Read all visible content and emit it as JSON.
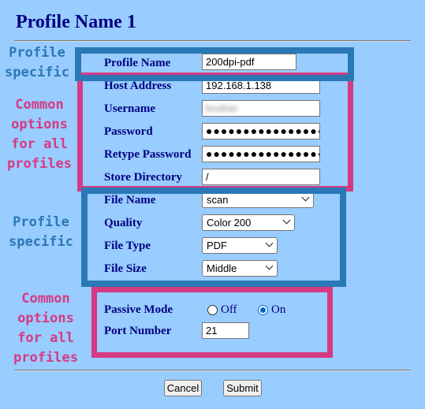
{
  "page": {
    "title": "Profile Name 1"
  },
  "annotations": {
    "profile_specific_1": [
      "Profile",
      "specific"
    ],
    "common_1": [
      "Common",
      "options",
      "for all",
      "profiles"
    ],
    "profile_specific_2": [
      "Profile",
      "specific"
    ],
    "common_2": [
      "Common",
      "options",
      "for all",
      "profiles"
    ]
  },
  "fields": {
    "profile_name": {
      "label": "Profile Name",
      "value": "200dpi-pdf"
    },
    "host_address": {
      "label": "Host Address",
      "value": "192.168.1.138"
    },
    "username": {
      "label": "Username",
      "value": "brother"
    },
    "password": {
      "label": "Password",
      "value": "●●●●●●●●●●●●●●●●"
    },
    "retype_password": {
      "label": "Retype Password",
      "value": "●●●●●●●●●●●●●●●●"
    },
    "store_directory": {
      "label": "Store Directory",
      "value": "/"
    },
    "file_name": {
      "label": "File Name",
      "value": "scan"
    },
    "quality": {
      "label": "Quality",
      "value": "Color 200"
    },
    "file_type": {
      "label": "File Type",
      "value": "PDF"
    },
    "file_size": {
      "label": "File Size",
      "value": "Middle"
    },
    "passive_mode": {
      "label": "Passive Mode",
      "options": [
        "Off",
        "On"
      ],
      "selected": "On"
    },
    "port_number": {
      "label": "Port Number",
      "value": "21"
    }
  },
  "buttons": {
    "cancel": "Cancel",
    "submit": "Submit"
  },
  "colors": {
    "background": "#99ccff",
    "label": "#000080",
    "profile_box": "#2a78b5",
    "common_box": "#d63a83"
  }
}
